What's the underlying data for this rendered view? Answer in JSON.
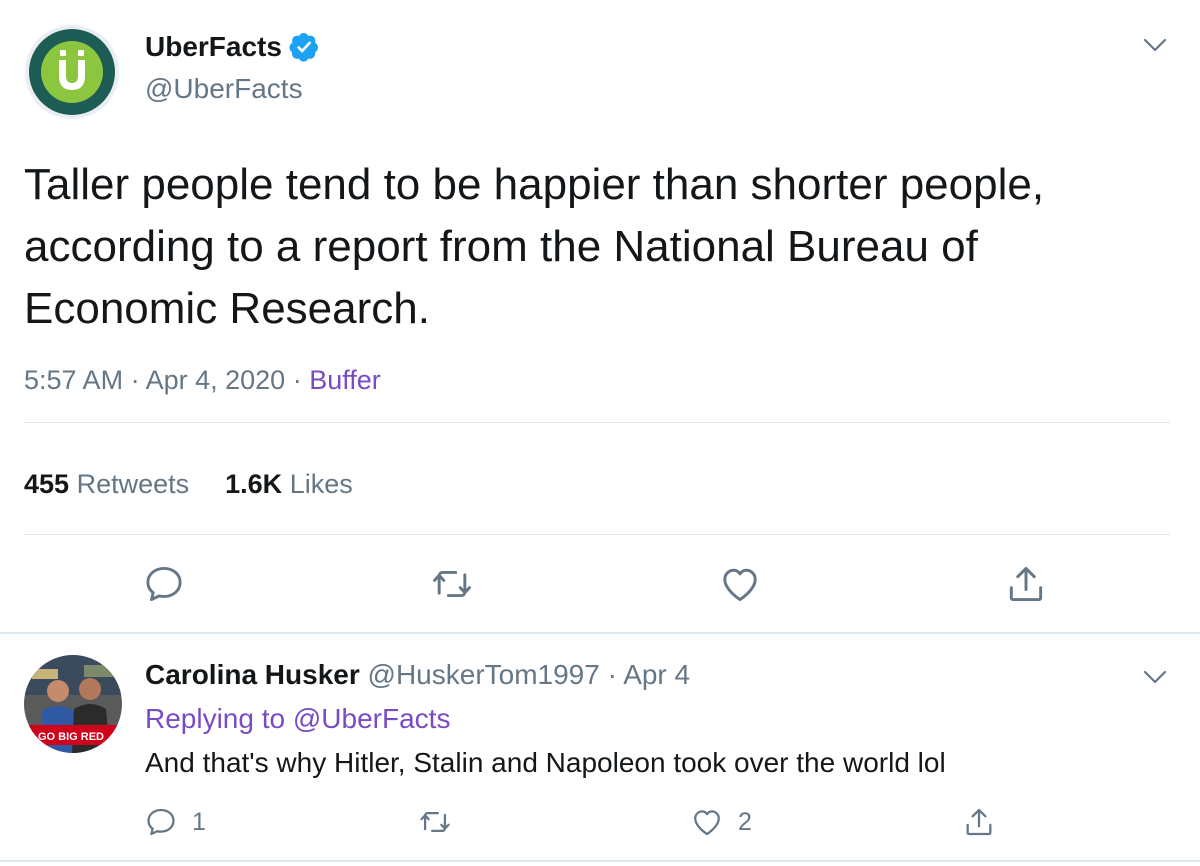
{
  "tweet": {
    "author": {
      "name": "UberFacts",
      "handle": "@UberFacts",
      "verified": true,
      "avatar_letter": "Ü"
    },
    "text": "Taller people tend to be happier than shorter people, according to a report from the National Bureau of Economic Research.",
    "time": "5:57 AM",
    "date": "Apr 4, 2020",
    "separator": "·",
    "source": "Buffer",
    "retweets_count": "455",
    "retweets_label": "Retweets",
    "likes_count": "1.6K",
    "likes_label": "Likes"
  },
  "reply": {
    "name": "Carolina Husker",
    "handle": "@HuskerTom1997",
    "separator": "·",
    "date": "Apr 4",
    "replying_label": "Replying to",
    "replying_handle": "@UberFacts",
    "text": "And that's why Hitler, Stalin and Napoleon took over the world lol",
    "reply_count": "1",
    "like_count": "2",
    "avatar_banner": "GO BIG RED"
  },
  "icons": {
    "reply": "reply-icon",
    "retweet": "retweet-icon",
    "like": "heart-icon",
    "share": "share-icon",
    "caret": "chevron-down-icon",
    "verified": "verified-badge-icon"
  },
  "colors": {
    "brand_green": "#8cc63f",
    "avatar_ring": "#1d5c55",
    "link": "#794bc4",
    "verified": "#1da1f2",
    "muted": "#657786",
    "divider": "#e1e8ed"
  }
}
